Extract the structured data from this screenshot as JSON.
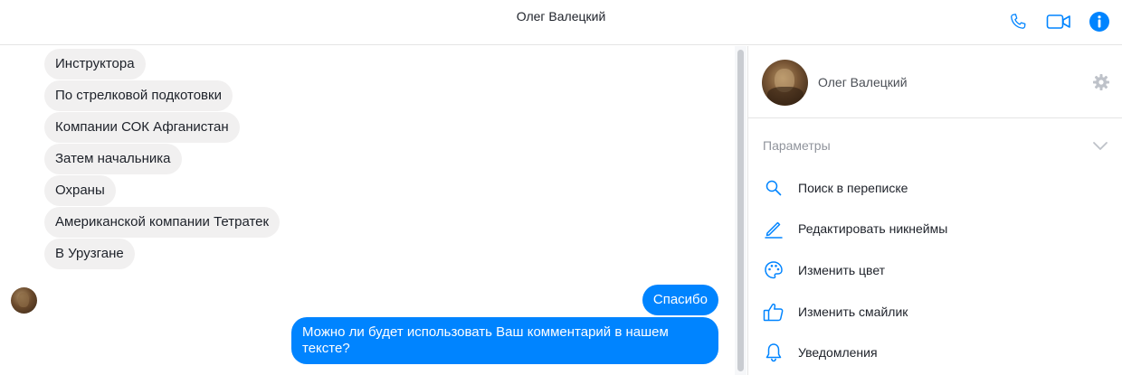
{
  "header": {
    "title": "Олег Валецкий",
    "icons": {
      "phone": "phone-icon",
      "video": "video-camera-icon",
      "info": "info-icon"
    },
    "accent": "#0084ff"
  },
  "conversation": {
    "incoming": [
      "Инструктора",
      "По стрелковой подкотовки",
      "Компании СОК Афганистан",
      "Затем начальника",
      "Охраны",
      "Американской компании Тетратек",
      "В Урузгане"
    ],
    "outgoing": [
      "Спасибо",
      "Можно ли будет использовать Ваш комментарий в нашем тексте?"
    ],
    "incoming_color": "#f1f0f0",
    "outgoing_color": "#0084ff"
  },
  "sidebar": {
    "profile_name": "Олег Валецкий",
    "settings_icon": "gear-icon",
    "section_title": "Параметры",
    "items": [
      {
        "label": "Поиск в переписке",
        "icon": "search-icon"
      },
      {
        "label": "Редактировать никнеймы",
        "icon": "pencil-icon"
      },
      {
        "label": "Изменить цвет",
        "icon": "palette-icon"
      },
      {
        "label": "Изменить смайлик",
        "icon": "thumbs-up-icon"
      },
      {
        "label": "Уведомления",
        "icon": "bell-icon"
      }
    ]
  }
}
